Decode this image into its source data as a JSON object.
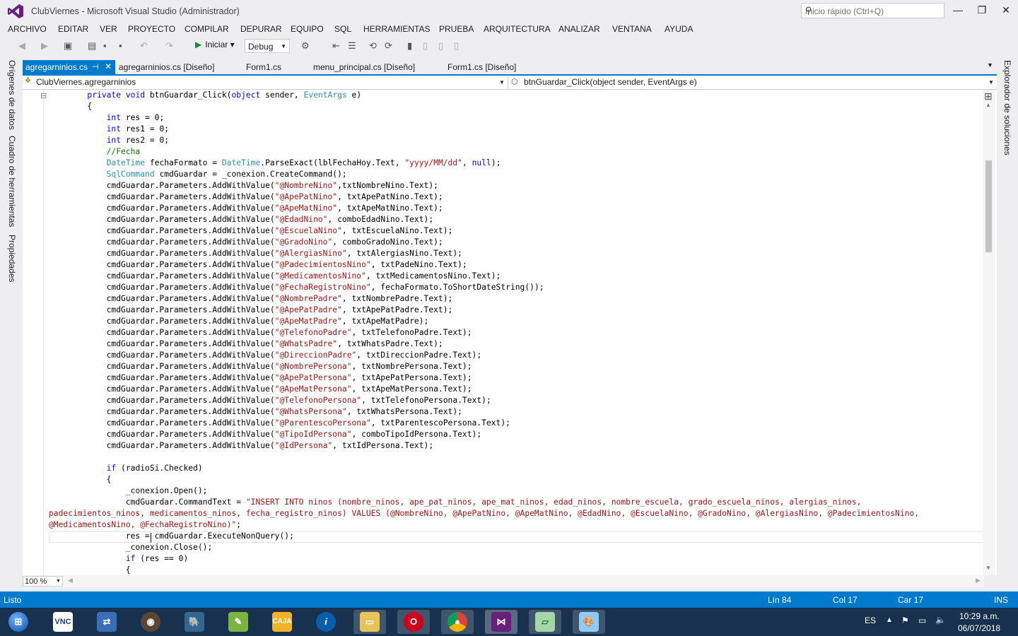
{
  "window": {
    "title": "ClubViernes - Microsoft Visual Studio (Administrador)",
    "quick_launch_placeholder": "Inicio rápido (Ctrl+Q)",
    "minimize": "—",
    "maximize": "❐",
    "close": "✕"
  },
  "menu": [
    "ARCHIVO",
    "EDITAR",
    "VER",
    "PROYECTO",
    "COMPILAR",
    "DEPURAR",
    "EQUIPO",
    "SQL",
    "HERRAMIENTAS",
    "PRUEBA",
    "ARQUITECTURA",
    "ANALIZAR",
    "VENTANA",
    "AYUDA"
  ],
  "toolbar": {
    "start_label": "Iniciar",
    "config": "Debug"
  },
  "left_panels": [
    "Orígenes de datos",
    "Cuadro de herramientas",
    "Propiedades"
  ],
  "right_panels": [
    "Explorador de soluciones"
  ],
  "doc_tabs": {
    "active": "agregarninios.cs",
    "others": [
      "agregarninios.cs [Diseño]",
      "Form1.cs",
      "menu_principal.cs [Diseño]",
      "Form1.cs [Diseño]"
    ]
  },
  "navbar": {
    "class_scope": "ClubViernes.agregarninios",
    "member_scope": "btnGuardar_Click(object sender, EventArgs e)"
  },
  "code_lines": [
    [
      {
        "t": "        "
      },
      {
        "t": "private",
        "c": "kw"
      },
      {
        "t": " "
      },
      {
        "t": "void",
        "c": "kw"
      },
      {
        "t": " btnGuardar_Click("
      },
      {
        "t": "object",
        "c": "kw"
      },
      {
        "t": " sender, "
      },
      {
        "t": "EventArgs",
        "c": "ty"
      },
      {
        "t": " e)"
      }
    ],
    [
      {
        "t": "        {"
      }
    ],
    [
      {
        "t": "            "
      },
      {
        "t": "int",
        "c": "kw"
      },
      {
        "t": " res = 0;"
      }
    ],
    [
      {
        "t": "            "
      },
      {
        "t": "int",
        "c": "kw"
      },
      {
        "t": " res1 = 0;"
      }
    ],
    [
      {
        "t": "            "
      },
      {
        "t": "int",
        "c": "kw"
      },
      {
        "t": " res2 = 0;"
      }
    ],
    [
      {
        "t": "            "
      },
      {
        "t": "//Fecha",
        "c": "cm"
      }
    ],
    [
      {
        "t": "            "
      },
      {
        "t": "DateTime",
        "c": "ty"
      },
      {
        "t": " fechaFormato = "
      },
      {
        "t": "DateTime",
        "c": "ty"
      },
      {
        "t": ".ParseExact(lblFechaHoy.Text, "
      },
      {
        "t": "\"yyyy/MM/dd\"",
        "c": "str"
      },
      {
        "t": ", "
      },
      {
        "t": "null",
        "c": "kw"
      },
      {
        "t": ");"
      }
    ],
    [
      {
        "t": "            "
      },
      {
        "t": "SqlCommand",
        "c": "ty"
      },
      {
        "t": " cmdGuardar = _conexion.CreateCommand();"
      }
    ],
    [
      {
        "t": "            cmdGuardar.Parameters.AddWithValue("
      },
      {
        "t": "\"@NombreNino\"",
        "c": "str"
      },
      {
        "t": ",txtNombreNino.Text);"
      }
    ],
    [
      {
        "t": "            cmdGuardar.Parameters.AddWithValue("
      },
      {
        "t": "\"@ApePatNino\"",
        "c": "str"
      },
      {
        "t": ", txtApePatNino.Text);"
      }
    ],
    [
      {
        "t": "            cmdGuardar.Parameters.AddWithValue("
      },
      {
        "t": "\"@ApeMatNino\"",
        "c": "str"
      },
      {
        "t": ", txtApeMatNino.Text);"
      }
    ],
    [
      {
        "t": "            cmdGuardar.Parameters.AddWithValue("
      },
      {
        "t": "\"@EdadNino\"",
        "c": "str"
      },
      {
        "t": ", comboEdadNino.Text);"
      }
    ],
    [
      {
        "t": "            cmdGuardar.Parameters.AddWithValue("
      },
      {
        "t": "\"@EscuelaNino\"",
        "c": "str"
      },
      {
        "t": ", txtEscuelaNino.Text);"
      }
    ],
    [
      {
        "t": "            cmdGuardar.Parameters.AddWithValue("
      },
      {
        "t": "\"@GradoNino\"",
        "c": "str"
      },
      {
        "t": ", comboGradoNino.Text);"
      }
    ],
    [
      {
        "t": "            cmdGuardar.Parameters.AddWithValue("
      },
      {
        "t": "\"@AlergiasNino\"",
        "c": "str"
      },
      {
        "t": ", txtAlergiasNino.Text);"
      }
    ],
    [
      {
        "t": "            cmdGuardar.Parameters.AddWithValue("
      },
      {
        "t": "\"@PadecimientosNino\"",
        "c": "str"
      },
      {
        "t": ", txtPadeNino.Text);"
      }
    ],
    [
      {
        "t": "            cmdGuardar.Parameters.AddWithValue("
      },
      {
        "t": "\"@MedicamentosNino\"",
        "c": "str"
      },
      {
        "t": ", txtMedicamentosNino.Text);"
      }
    ],
    [
      {
        "t": "            cmdGuardar.Parameters.AddWithValue("
      },
      {
        "t": "\"@FechaRegistroNino\"",
        "c": "str"
      },
      {
        "t": ", fechaFormato.ToShortDateString());"
      }
    ],
    [
      {
        "t": "            cmdGuardar.Parameters.AddWithValue("
      },
      {
        "t": "\"@NombrePadre\"",
        "c": "str"
      },
      {
        "t": ", txtNombrePadre.Text);"
      }
    ],
    [
      {
        "t": "            cmdGuardar.Parameters.AddWithValue("
      },
      {
        "t": "\"@ApePatPadre\"",
        "c": "str"
      },
      {
        "t": ", txtApePatPadre.Text);"
      }
    ],
    [
      {
        "t": "            cmdGuardar.Parameters.AddWithValue("
      },
      {
        "t": "\"@ApeMatPadre\"",
        "c": "str"
      },
      {
        "t": ", txtApeMatPadre);"
      }
    ],
    [
      {
        "t": "            cmdGuardar.Parameters.AddWithValue("
      },
      {
        "t": "\"@TelefonoPadre\"",
        "c": "str"
      },
      {
        "t": ", txtTelefonoPadre.Text);"
      }
    ],
    [
      {
        "t": "            cmdGuardar.Parameters.AddWithValue("
      },
      {
        "t": "\"@WhatsPadre\"",
        "c": "str"
      },
      {
        "t": ", txtWhatsPadre.Text);"
      }
    ],
    [
      {
        "t": "            cmdGuardar.Parameters.AddWithValue("
      },
      {
        "t": "\"@DireccionPadre\"",
        "c": "str"
      },
      {
        "t": ", txtDireccionPadre.Text);"
      }
    ],
    [
      {
        "t": "            cmdGuardar.Parameters.AddWithValue("
      },
      {
        "t": "\"@NombrePersona\"",
        "c": "str"
      },
      {
        "t": ", txtNombrePersona.Text);"
      }
    ],
    [
      {
        "t": "            cmdGuardar.Parameters.AddWithValue("
      },
      {
        "t": "\"@ApePatPersona\"",
        "c": "str"
      },
      {
        "t": ", txtApePatPersona.Text);"
      }
    ],
    [
      {
        "t": "            cmdGuardar.Parameters.AddWithValue("
      },
      {
        "t": "\"@ApeMatPersona\"",
        "c": "str"
      },
      {
        "t": ", txtApeMatPersona.Text);"
      }
    ],
    [
      {
        "t": "            cmdGuardar.Parameters.AddWithValue("
      },
      {
        "t": "\"@TelefonoPersona\"",
        "c": "str"
      },
      {
        "t": ", txtTelefonoPersona.Text);"
      }
    ],
    [
      {
        "t": "            cmdGuardar.Parameters.AddWithValue("
      },
      {
        "t": "\"@WhatsPersona\"",
        "c": "str"
      },
      {
        "t": ", txtWhatsPersona.Text);"
      }
    ],
    [
      {
        "t": "            cmdGuardar.Parameters.AddWithValue("
      },
      {
        "t": "\"@ParentescoPersona\"",
        "c": "str"
      },
      {
        "t": ", txtParentescoPersona.Text);"
      }
    ],
    [
      {
        "t": "            cmdGuardar.Parameters.AddWithValue("
      },
      {
        "t": "\"@TipoIdPersona\"",
        "c": "str"
      },
      {
        "t": ", comboTipoIdPersona.Text);"
      }
    ],
    [
      {
        "t": "            cmdGuardar.Parameters.AddWithValue("
      },
      {
        "t": "\"@IdPersona\"",
        "c": "str"
      },
      {
        "t": ", txtIdPersona.Text);"
      }
    ],
    [
      {
        "t": ""
      }
    ],
    [
      {
        "t": "            "
      },
      {
        "t": "if",
        "c": "kw"
      },
      {
        "t": " (radioSi.Checked)"
      }
    ],
    [
      {
        "t": "            {"
      }
    ],
    [
      {
        "t": "                _conexion.Open();"
      }
    ],
    [
      {
        "t": "                cmdGuardar.CommandText = "
      },
      {
        "t": "\"INSERT INTO ninos (nombre_ninos, ape_pat_ninos, ape_mat_ninos, edad_ninos, nombre_escuela, grado_escuela_ninos, alergias_ninos,",
        "c": "str"
      }
    ],
    [
      {
        "t": "padecimientos_ninos, medicamentos_ninos, fecha_registro_ninos) VALUES (@NombreNino, @ApePatNino, @ApeMatNino, @EdadNino, @EscuelaNino, @GradoNino, @AlergiasNino, @PadecimientosNino,",
        "c": "str"
      }
    ],
    [
      {
        "t": "@MedicamentosNino, @FechaRegistroNino)\"",
        "c": "str"
      },
      {
        "t": ";"
      }
    ],
    [
      {
        "t": "                res = cmdGuardar.ExecuteNonQuery();"
      }
    ],
    [
      {
        "t": "                _conexion.Close();"
      }
    ],
    [
      {
        "t": "                "
      },
      {
        "t": "if",
        "c": "kw"
      },
      {
        "t": " (res == 0)"
      }
    ],
    [
      {
        "t": "                {"
      }
    ]
  ],
  "editor": {
    "zoom": "100 %",
    "collapse_glyph": "⊟"
  },
  "status": {
    "ready": "Listo",
    "line": "Lín 84",
    "col": "Col 17",
    "char": "Car 17",
    "mode": "INS"
  },
  "taskbar": {
    "apps": [
      "start",
      "vnc",
      "network",
      "webcam",
      "postgresql",
      "notepad-plus",
      "caja",
      "app-i",
      "file-explorer",
      "opera",
      "chrome",
      "visual-studio",
      "folder-files",
      "paint"
    ],
    "language": "ES",
    "time": "10:29 a.m.",
    "date": "06/07/2018"
  },
  "colors": {
    "accent": "#007acc",
    "keyword": "#0000ff",
    "type": "#2b91af",
    "string": "#a31515",
    "comment": "#008000",
    "taskbar": "#17314e"
  }
}
